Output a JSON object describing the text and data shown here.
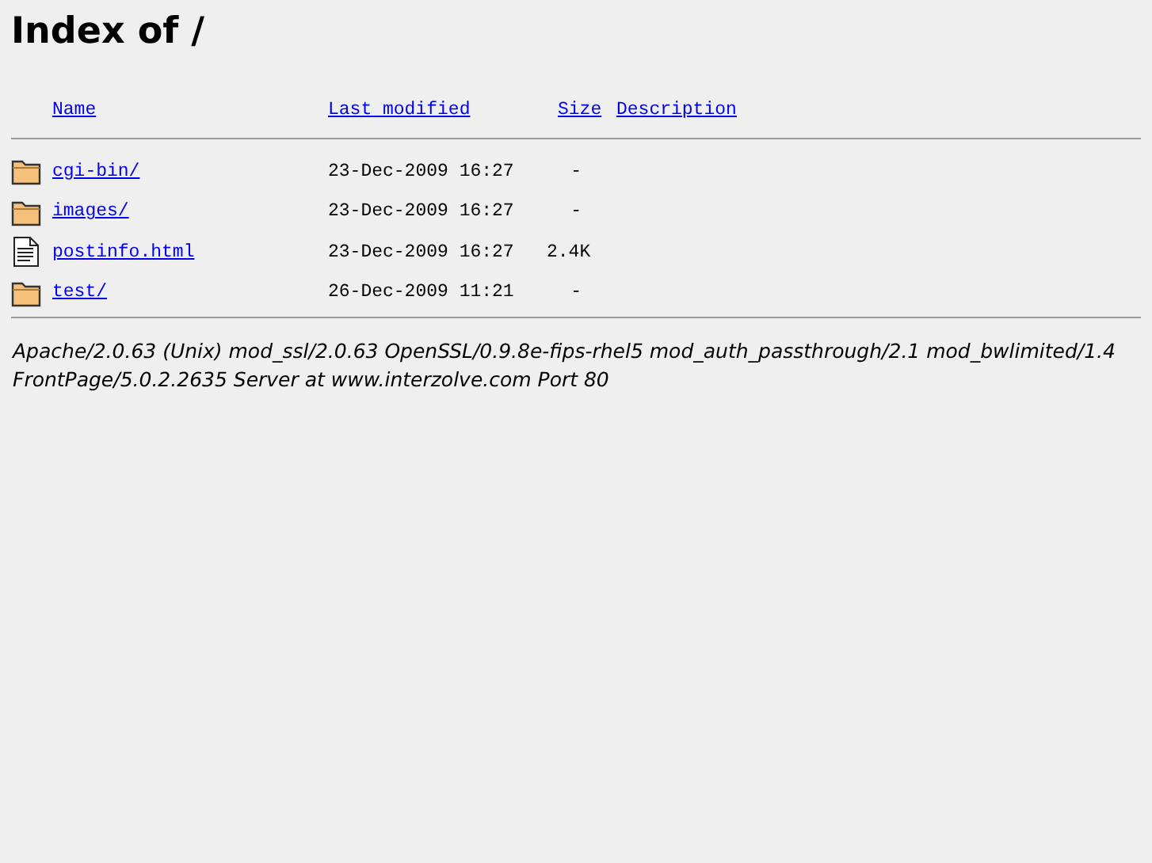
{
  "title": "Index of /",
  "columns": [
    "Name",
    "Last modified",
    "Size",
    "Description"
  ],
  "rows": [
    {
      "kind": "folder",
      "name": "cgi-bin/",
      "modified": "23-Dec-2009 16:27",
      "size": "-"
    },
    {
      "kind": "folder",
      "name": "images/",
      "modified": "23-Dec-2009 16:27",
      "size": "-"
    },
    {
      "kind": "file",
      "name": "postinfo.html",
      "modified": "23-Dec-2009 16:27",
      "size": "2.4K"
    },
    {
      "kind": "folder",
      "name": "test/",
      "modified": "26-Dec-2009 11:21",
      "size": "-"
    }
  ],
  "address": "Apache/2.0.63 (Unix) mod_ssl/2.0.63 OpenSSL/0.9.8e-fips-rhel5 mod_auth_passthrough/2.1 mod_bwlimited/1.4 FrontPage/5.0.2.2635 Server at www.interzolve.com Port 80"
}
